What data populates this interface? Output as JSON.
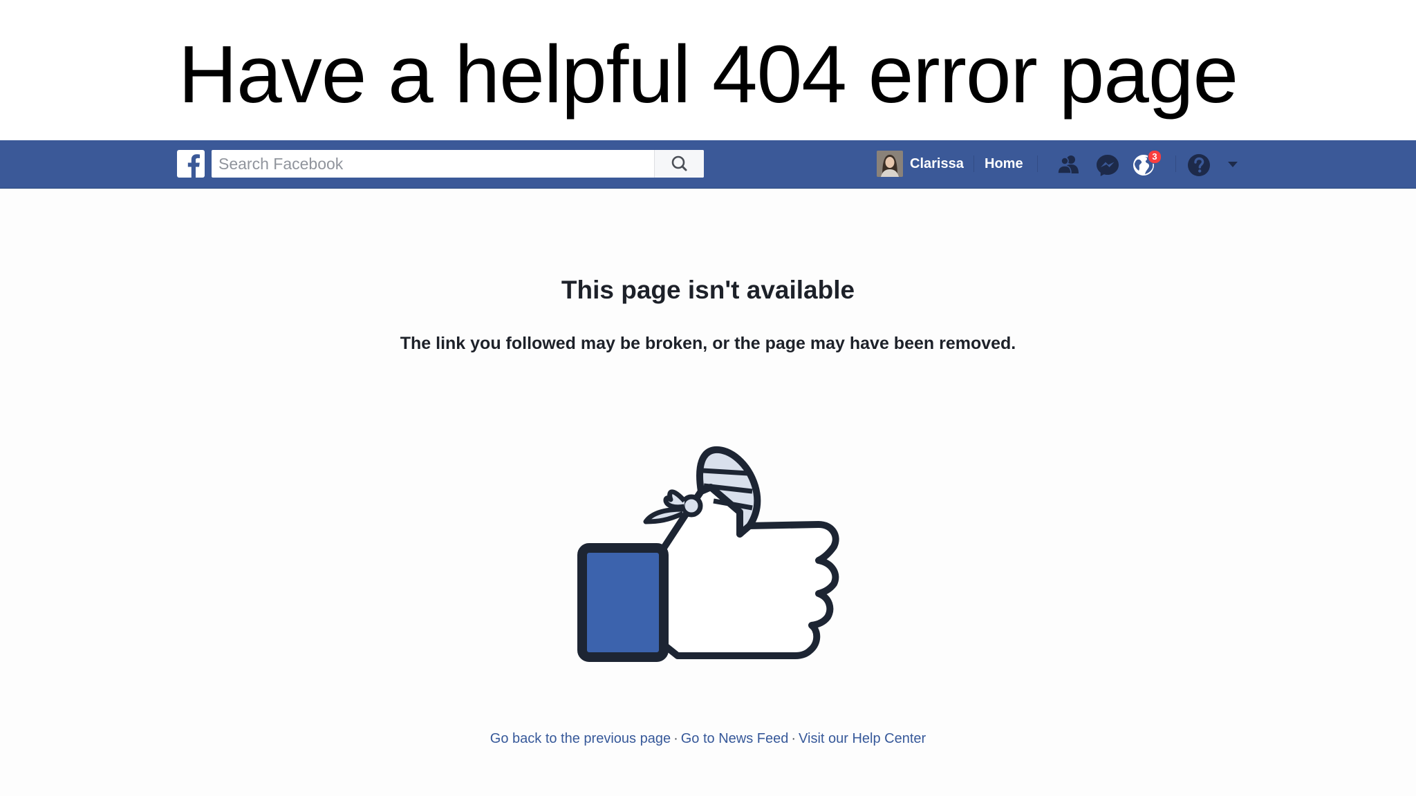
{
  "slide": {
    "title": "Have a helpful 404 error page"
  },
  "topbar": {
    "logo_icon": "facebook-f-icon",
    "search_placeholder": "Search Facebook",
    "search_icon": "search-icon",
    "profile_name": "Clarissa",
    "home_label": "Home",
    "friend_requests_icon": "friends-icon",
    "messages_icon": "messenger-icon",
    "notifications_icon": "globe-icon",
    "notifications_count": "3",
    "help_icon": "question-icon",
    "menu_icon": "caret-down-icon",
    "brand_color": "#3b5998"
  },
  "content": {
    "title": "This page isn't available",
    "message": "The link you followed may be broken, or the page may have been removed.",
    "illustration": "bandaged-thumbs-up-icon"
  },
  "footer": {
    "links": [
      "Go back to the previous page",
      "Go to News Feed",
      "Visit our Help Center"
    ],
    "separator": "·"
  }
}
